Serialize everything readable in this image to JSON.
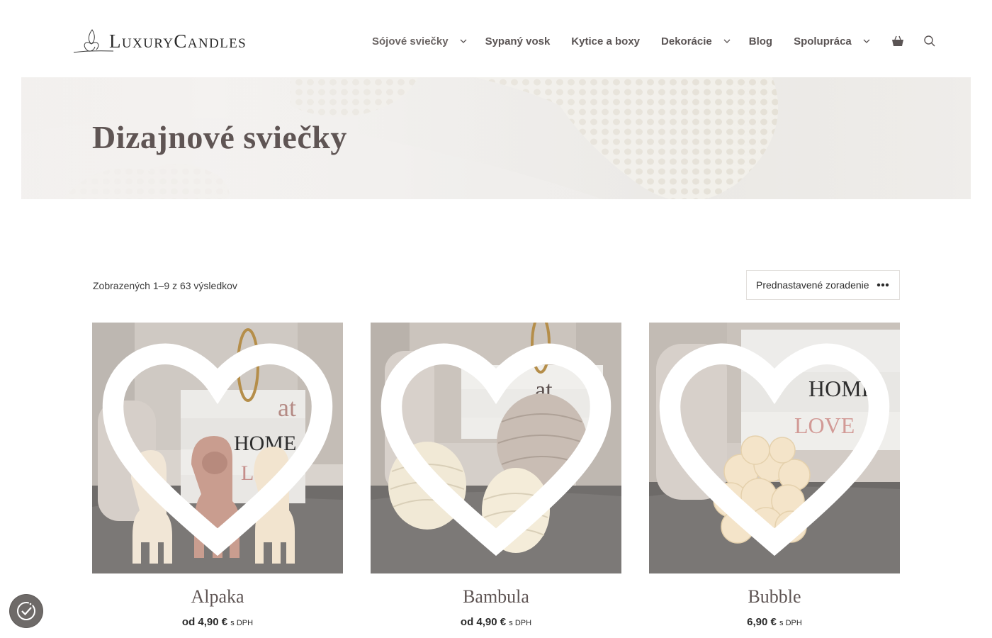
{
  "brand": {
    "logo_text": "LuxuryCandles"
  },
  "nav": {
    "items": [
      {
        "label": "Sójové sviečky",
        "has_dropdown": true
      },
      {
        "label": "Sypaný vosk",
        "has_dropdown": false
      },
      {
        "label": "Kytice a boxy",
        "has_dropdown": false
      },
      {
        "label": "Dekorácie",
        "has_dropdown": true
      },
      {
        "label": "Blog",
        "has_dropdown": false
      },
      {
        "label": "Spolupráca",
        "has_dropdown": true
      }
    ],
    "icons": [
      "basket-icon",
      "search-icon"
    ]
  },
  "hero": {
    "title": "Dizajnové sviečky"
  },
  "shop": {
    "result_count": "Zobrazených 1–9 z 63 výsledkov",
    "sort_label": "Prednastavené zoradenie"
  },
  "products": [
    {
      "name": "Alpaka",
      "price": "od 4,90 €",
      "price_suffix": "s DPH"
    },
    {
      "name": "Bambula",
      "price": "od 4,90 €",
      "price_suffix": "s DPH"
    },
    {
      "name": "Bubble",
      "price": "6,90 €",
      "price_suffix": "s DPH"
    }
  ],
  "colors": {
    "accent": "#5f5554",
    "nav_text": "#5a5454",
    "cookie_button": "#6e6a68"
  }
}
